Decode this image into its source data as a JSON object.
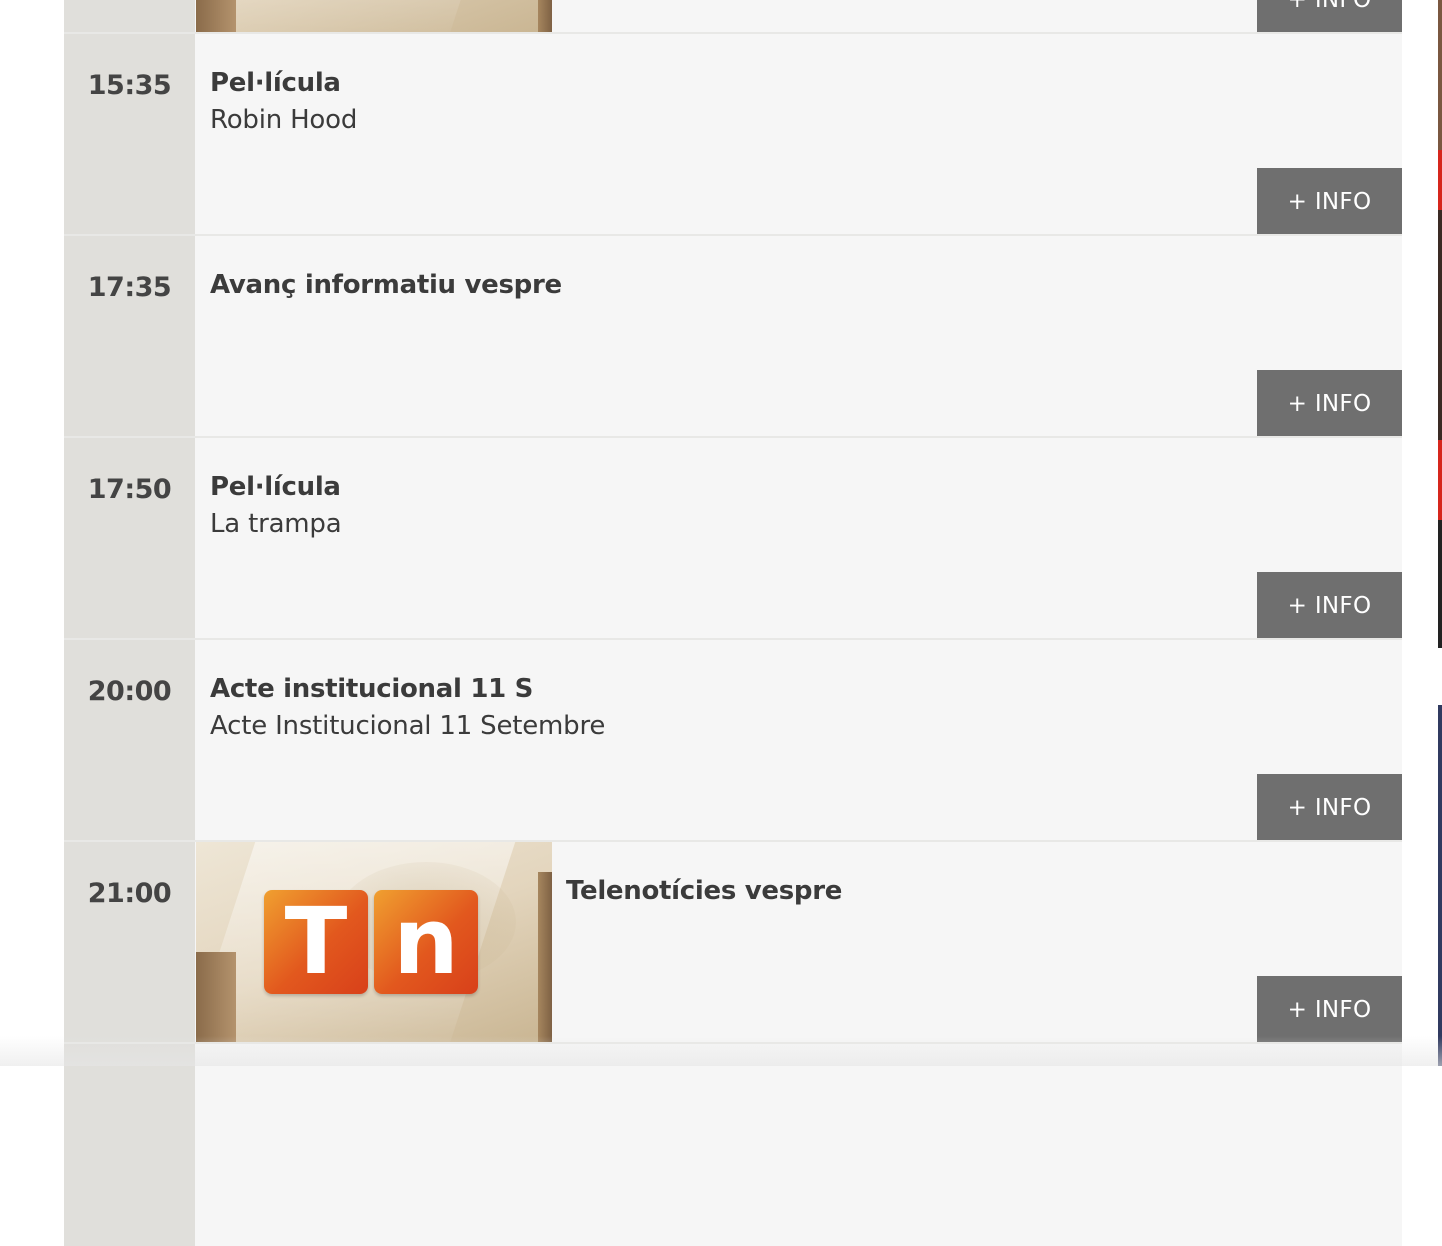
{
  "schedule": {
    "info_label": "+ INFO",
    "items": [
      {
        "time": "",
        "title": "",
        "subtitle": "",
        "thumbnail": "news-studio-image"
      },
      {
        "time": "15:35",
        "title": "Pel·lícula",
        "subtitle": "Robin Hood"
      },
      {
        "time": "17:35",
        "title": "Avanç informatiu vespre",
        "subtitle": ""
      },
      {
        "time": "17:50",
        "title": "Pel·lícula",
        "subtitle": "La trampa"
      },
      {
        "time": "20:00",
        "title": "Acte institucional 11 S",
        "subtitle": "Acte Institucional 11 Setembre"
      },
      {
        "time": "21:00",
        "title": "Telenotícies vespre",
        "subtitle": "",
        "thumbnail": "tn-logo-image",
        "logo_letters": [
          "T",
          "n"
        ]
      }
    ]
  },
  "colors": {
    "time_column": "#e0dfdb",
    "row_background": "#f6f6f6",
    "info_button": "#6f6f6f",
    "text": "#3b3b3b",
    "logo_orange": "#e2581e"
  }
}
